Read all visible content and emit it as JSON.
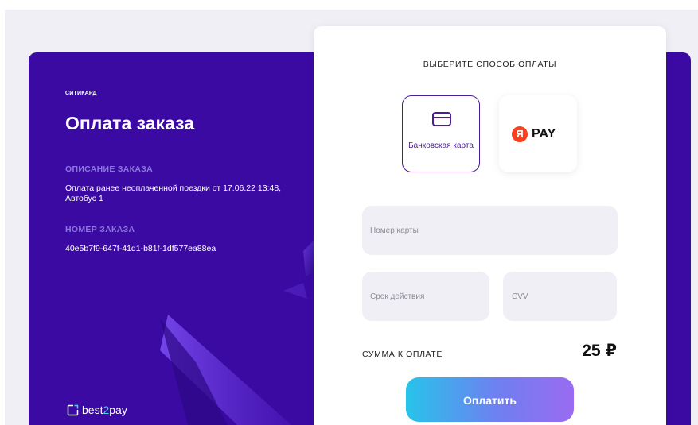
{
  "order": {
    "merchant": "СИТИКАРД",
    "title": "Оплата заказа",
    "description_label": "ОПИСАНИЕ ЗАКАЗА",
    "description": "Оплата ранее неоплаченной поездки от 17.06.22 13:48, Автобус 1",
    "number_label": "НОМЕР ЗАКАЗА",
    "number": "40e5b7f9-647f-41d1-b81f-1df577ea88ea"
  },
  "brand": {
    "prefix": "best",
    "accent": "2",
    "suffix": "pay"
  },
  "payment": {
    "title": "ВЫБЕРИТЕ СПОСОБ ОПЛАТЫ",
    "methods": [
      {
        "label": "Банковская карта",
        "icon": "credit-card-icon",
        "selected": true
      },
      {
        "label": "PAY",
        "icon": "yandex-pay-logo",
        "selected": false
      }
    ],
    "yandex_letter": "Я",
    "fields": {
      "card_number_placeholder": "Номер карты",
      "expiry_placeholder": "Срок действия",
      "cvv_placeholder": "CVV"
    },
    "sum_label": "СУММА К ОПЛАТЕ",
    "sum_value": "25 ₽",
    "pay_button": "Оплатить"
  },
  "colors": {
    "panel": "#3b0aa3",
    "accent": "#4a1c95",
    "yandex_red": "#fc3f1d",
    "button_start": "#27c4ea",
    "button_end": "#9a6bf0"
  }
}
